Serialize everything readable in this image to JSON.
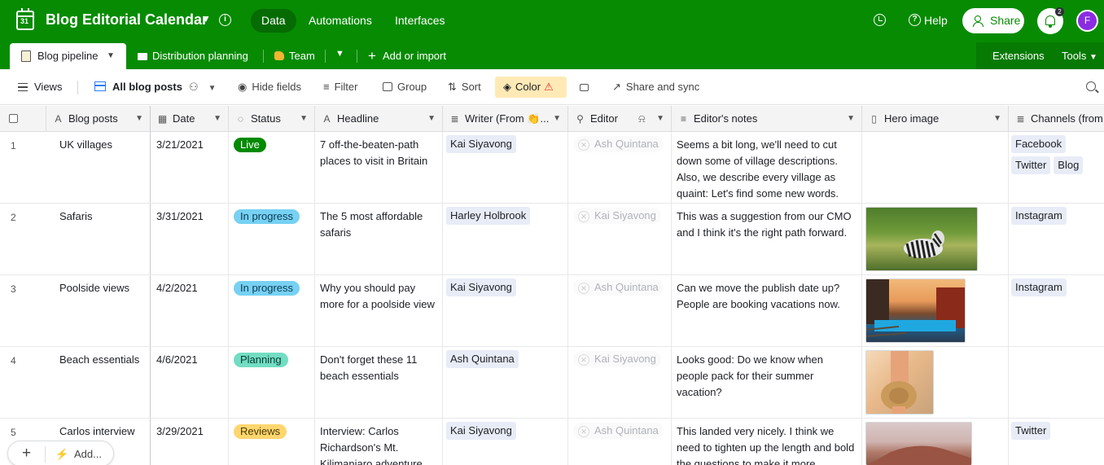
{
  "app": {
    "base_title": "Blog Editorial Calendar",
    "calendar_day": "31",
    "nav": [
      "Data",
      "Automations",
      "Interfaces"
    ],
    "help": "Help",
    "share": "Share",
    "notification_count": "2",
    "avatar_initial": "F",
    "brand_color": "#078b03"
  },
  "tabs": {
    "active": "Blog pipeline",
    "items": [
      "Distribution planning",
      "Team"
    ],
    "add": "Add or import",
    "extensions": "Extensions",
    "tools": "Tools"
  },
  "viewbar": {
    "views": "Views",
    "current_view": "All blog posts",
    "hide_fields": "Hide fields",
    "filter": "Filter",
    "group": "Group",
    "sort": "Sort",
    "color": "Color",
    "share_sync": "Share and sync"
  },
  "columns": [
    "Blog posts",
    "Date",
    "Status",
    "Headline",
    "Writer (From 👏...",
    "Editor",
    "Editor's notes",
    "Hero image",
    "Channels (from"
  ],
  "rows": [
    {
      "num": "1",
      "post": "UK villages",
      "date": "3/21/2021",
      "status": "Live",
      "status_bg": "#008a00",
      "status_fg": "#ffffff",
      "headline": "7 off-the-beaten-path places to visit in Britain",
      "writer": "Kai Siyavong",
      "editor": "Ash Quintana",
      "notes": "Seems a bit long, we'll need to cut down some of village descriptions. Also, we describe every village as quaint: Let's find some new words.",
      "channels": [
        "Facebook",
        "Twitter",
        "Blog"
      ]
    },
    {
      "num": "2",
      "post": "Safaris",
      "date": "3/31/2021",
      "status": "In progress",
      "status_bg": "#77d1f3",
      "status_fg": "#0b3a52",
      "headline": "The 5 most affordable safaris",
      "writer": "Harley Holbrook",
      "editor": "Kai Siyavong",
      "notes": "This was a suggestion from our CMO and I think it's the right path forward.",
      "channels": [
        "Instagram"
      ]
    },
    {
      "num": "3",
      "post": "Poolside views",
      "date": "4/2/2021",
      "status": "In progress",
      "status_bg": "#77d1f3",
      "status_fg": "#0b3a52",
      "headline": "Why you should pay more for a poolside view",
      "writer": "Kai Siyavong",
      "editor": "Ash Quintana",
      "notes": "Can we move the publish date up? People are booking vacations now.",
      "channels": [
        "Instagram"
      ]
    },
    {
      "num": "4",
      "post": "Beach essentials",
      "date": "4/6/2021",
      "status": "Planning",
      "status_bg": "#72ddc3",
      "status_fg": "#0b3a32",
      "headline": "Don't forget these 11 beach essentials",
      "writer": "Ash Quintana",
      "editor": "Kai Siyavong",
      "notes": "Looks good: Do we know when people pack for their summer vacation?",
      "channels": []
    },
    {
      "num": "5",
      "post": "Carlos interview",
      "date": "3/29/2021",
      "status": "Reviews",
      "status_bg": "#ffd66e",
      "status_fg": "#4a3a06",
      "headline": "Interview: Carlos Richardson's Mt. Kilimanjaro adventure",
      "writer": "Kai Siyavong",
      "editor": "Ash Quintana",
      "notes": "This landed very nicely. I think we need to tighten up the length and bold the questions to make it more",
      "channels": [
        "Twitter"
      ]
    }
  ],
  "bottom": {
    "add": "Add..."
  }
}
